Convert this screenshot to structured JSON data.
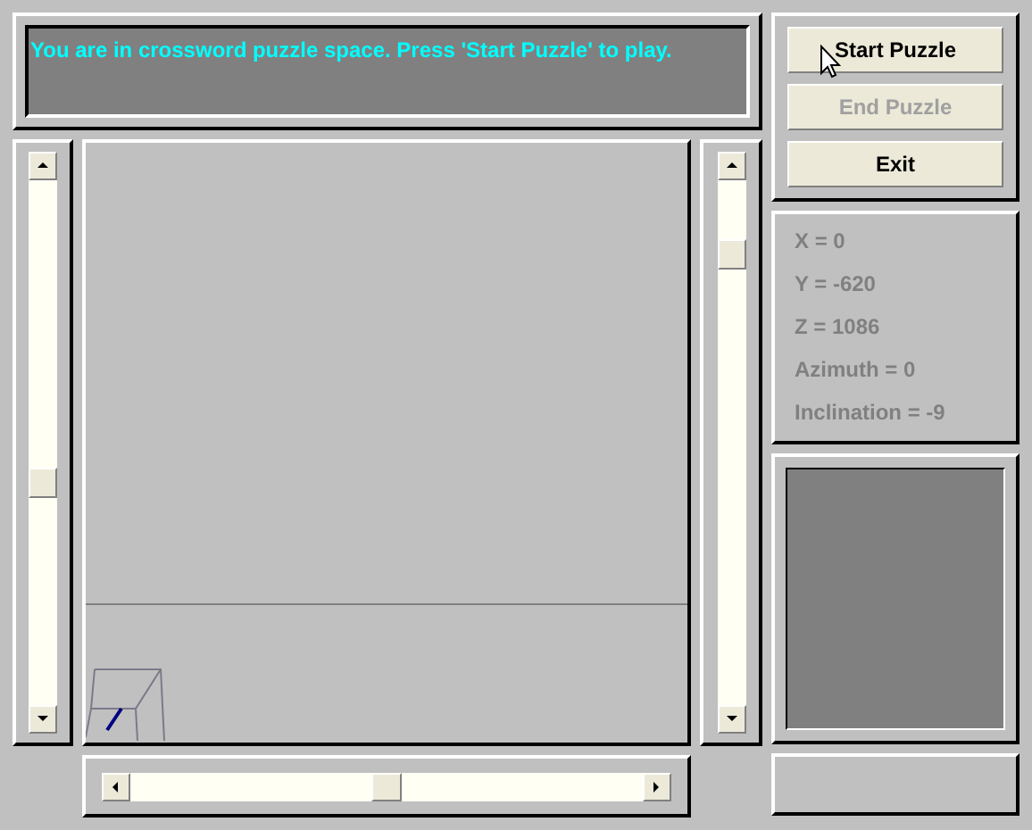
{
  "message": "You are in crossword puzzle space. Press 'Start Puzzle' to play.",
  "buttons": [
    {
      "label": "Start Puzzle",
      "disabled": false
    },
    {
      "label": "End Puzzle",
      "disabled": true
    },
    {
      "label": "Exit",
      "disabled": false
    }
  ],
  "readouts": [
    "X = 0",
    "Y = -620",
    "Z = 1086",
    "Azimuth = 0",
    "Inclination = -9"
  ]
}
